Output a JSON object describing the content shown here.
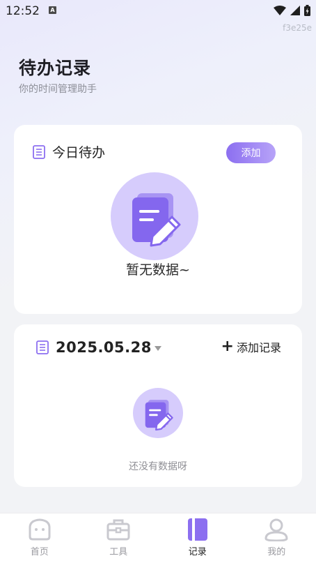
{
  "status_bar": {
    "time": "12:52",
    "notification_glyph": "A",
    "build_tag": "f3e25e"
  },
  "header": {
    "title": "待办记录",
    "subtitle": "你的时间管理助手"
  },
  "today_card": {
    "title": "今日待办",
    "add_label": "添加",
    "empty_text": "暂无数据~"
  },
  "record_card": {
    "date": "2025.05.28",
    "add_record_label": "添加记录",
    "empty_text": "还没有数据呀"
  },
  "tabs": [
    {
      "label": "首页",
      "icon": "home-icon",
      "active": false
    },
    {
      "label": "工具",
      "icon": "toolbox-icon",
      "active": false
    },
    {
      "label": "记录",
      "icon": "record-icon",
      "active": true
    },
    {
      "label": "我的",
      "icon": "profile-icon",
      "active": false
    }
  ],
  "colors": {
    "accent": "#8c6ff0",
    "accent_light": "#d6ccfc",
    "tab_inactive": "#c9c9cf"
  }
}
